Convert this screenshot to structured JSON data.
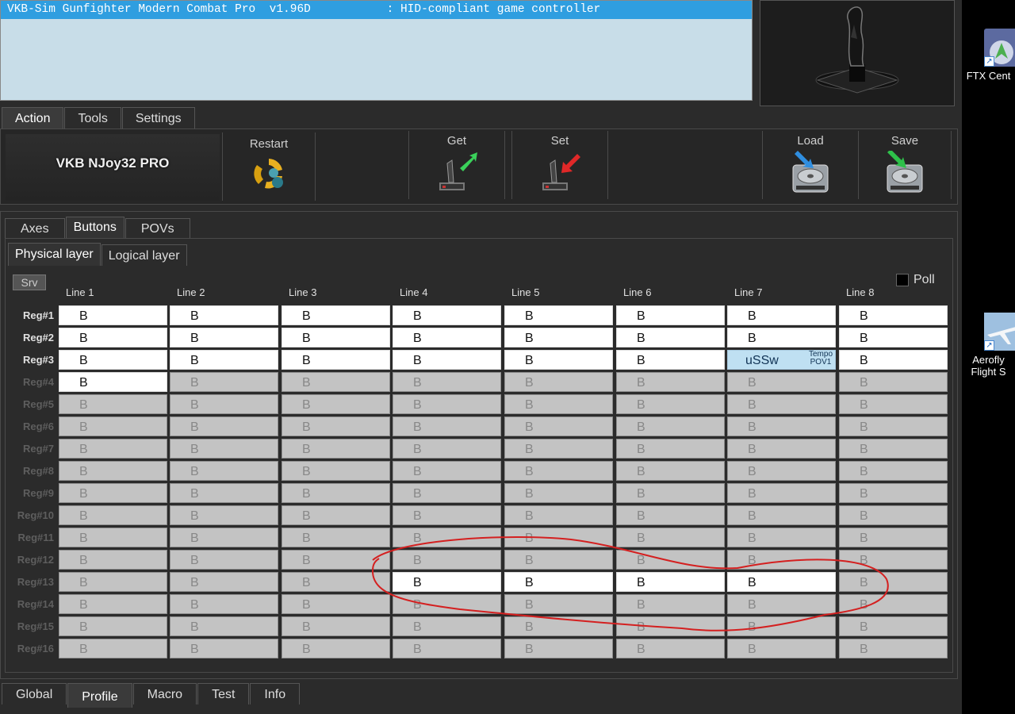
{
  "device_list": {
    "selected_row": "VKB-Sim Gunfighter Modern Combat Pro  v1.96D           : HID-compliant game controller"
  },
  "top_tabs": [
    "Action",
    "Tools",
    "Settings"
  ],
  "toolbar": {
    "device_name": "VKB NJoy32 PRO",
    "restart_label": "Restart",
    "get_label": "Get",
    "set_label": "Set",
    "load_label": "Load",
    "save_label": "Save"
  },
  "sub_tabs": [
    "Axes",
    "Buttons",
    "POVs"
  ],
  "layer_tabs": [
    "Physical layer",
    "Logical layer"
  ],
  "srv_label": "Srv",
  "poll_label": "Poll",
  "grid": {
    "columns": [
      "Line 1",
      "Line 2",
      "Line 3",
      "Line 4",
      "Line 5",
      "Line 6",
      "Line 7",
      "Line 8"
    ],
    "rows": [
      "Reg#1",
      "Reg#2",
      "Reg#3",
      "Reg#4",
      "Reg#5",
      "Reg#6",
      "Reg#7",
      "Reg#8",
      "Reg#9",
      "Reg#10",
      "Reg#11",
      "Reg#12",
      "Reg#13",
      "Reg#14",
      "Reg#15",
      "Reg#16"
    ],
    "active_rows": [
      0,
      1,
      2
    ],
    "cell_text": "B",
    "cells": [
      [
        "B",
        "B",
        "B",
        "B",
        "B",
        "B",
        "B",
        "B"
      ],
      [
        "B",
        "B",
        "B",
        "B",
        "B",
        "B",
        "B",
        "B"
      ],
      [
        "B",
        "B",
        "B",
        "B",
        "B",
        "B",
        "uSSw",
        "B"
      ],
      [
        "B",
        "B",
        "B",
        "B",
        "B",
        "B",
        "B",
        "B"
      ],
      [
        "B",
        "B",
        "B",
        "B",
        "B",
        "B",
        "B",
        "B"
      ],
      [
        "B",
        "B",
        "B",
        "B",
        "B",
        "B",
        "B",
        "B"
      ],
      [
        "B",
        "B",
        "B",
        "B",
        "B",
        "B",
        "B",
        "B"
      ],
      [
        "B",
        "B",
        "B",
        "B",
        "B",
        "B",
        "B",
        "B"
      ],
      [
        "B",
        "B",
        "B",
        "B",
        "B",
        "B",
        "B",
        "B"
      ],
      [
        "B",
        "B",
        "B",
        "B",
        "B",
        "B",
        "B",
        "B"
      ],
      [
        "B",
        "B",
        "B",
        "B",
        "B",
        "B",
        "B",
        "B"
      ],
      [
        "B",
        "B",
        "B",
        "B",
        "B",
        "B",
        "B",
        "B"
      ],
      [
        "B",
        "B",
        "B",
        "B",
        "B",
        "B",
        "B",
        "B"
      ],
      [
        "B",
        "B",
        "B",
        "B",
        "B",
        "B",
        "B",
        "B"
      ],
      [
        "B",
        "B",
        "B",
        "B",
        "B",
        "B",
        "B",
        "B"
      ],
      [
        "B",
        "B",
        "B",
        "B",
        "B",
        "B",
        "B",
        "B"
      ]
    ],
    "on_cells": [
      [
        0,
        0
      ],
      [
        0,
        1
      ],
      [
        0,
        2
      ],
      [
        0,
        3
      ],
      [
        0,
        4
      ],
      [
        0,
        5
      ],
      [
        0,
        6
      ],
      [
        0,
        7
      ],
      [
        1,
        0
      ],
      [
        1,
        1
      ],
      [
        1,
        2
      ],
      [
        1,
        3
      ],
      [
        1,
        4
      ],
      [
        1,
        5
      ],
      [
        1,
        6
      ],
      [
        1,
        7
      ],
      [
        2,
        0
      ],
      [
        2,
        1
      ],
      [
        2,
        2
      ],
      [
        2,
        3
      ],
      [
        2,
        4
      ],
      [
        2,
        5
      ],
      [
        2,
        7
      ],
      [
        3,
        0
      ],
      [
        12,
        3
      ],
      [
        12,
        4
      ],
      [
        12,
        5
      ],
      [
        12,
        6
      ]
    ],
    "pov_cell": {
      "row": 2,
      "col": 6,
      "sub1": "Tempo",
      "sub2": "POV1"
    }
  },
  "bottom_tabs": [
    "Global",
    "Profile",
    "Macro",
    "Test",
    "Info"
  ],
  "bottom_active": 1,
  "desktop_icons": [
    {
      "label": "FTX Cent",
      "icon": "ftx-central-icon"
    },
    {
      "label_line1": "Aerofly",
      "label_line2": "Flight S",
      "icon": "aerofly-icon"
    }
  ],
  "colors": {
    "selected_row": "#2f9ee0",
    "cell_on": "#ffffff",
    "cell_off": "#c3c3c3",
    "pov_cell": "#bfe0f2",
    "annotation": "#d42020"
  }
}
